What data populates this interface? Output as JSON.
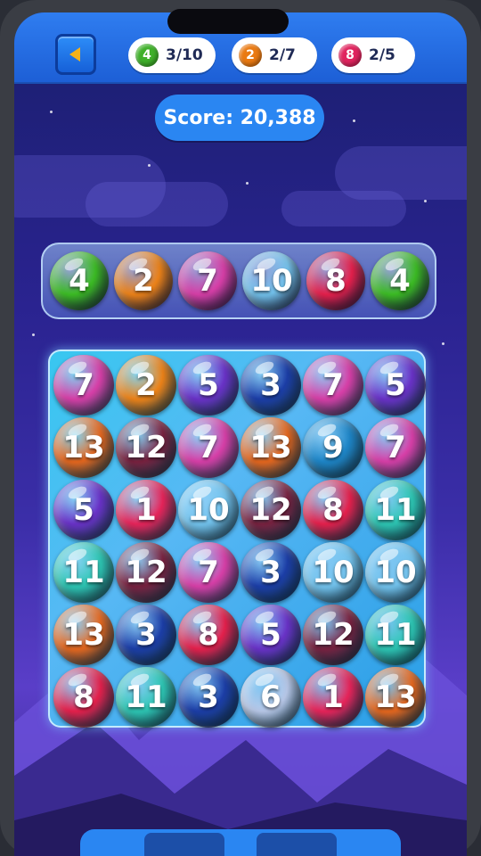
{
  "goals": [
    {
      "number": "4",
      "progress": "3/10",
      "color": "#3fb02a"
    },
    {
      "number": "2",
      "progress": "2/7",
      "color": "#ea7a12"
    },
    {
      "number": "8",
      "progress": "2/5",
      "color": "#e0245e"
    }
  ],
  "score_text": "Score: 20,388",
  "queue": [
    "4",
    "2",
    "7",
    "10",
    "8",
    "4"
  ],
  "grid": [
    [
      "7",
      "2",
      "5",
      "3",
      "7",
      "5"
    ],
    [
      "13",
      "12",
      "7",
      "13",
      "9",
      "7"
    ],
    [
      "5",
      "1",
      "10",
      "12",
      "8",
      "11"
    ],
    [
      "11",
      "12",
      "7",
      "3",
      "10",
      "10"
    ],
    [
      "13",
      "3",
      "8",
      "5",
      "12",
      "11"
    ],
    [
      "8",
      "11",
      "3",
      "6",
      "1",
      "13"
    ]
  ],
  "ball_colors": {
    "1": "#e8245a",
    "2": "#ee8318",
    "3": "#1c3ea8",
    "4": "#3cbd24",
    "5": "#6a32c8",
    "6": "#b8c8e8",
    "7": "#d83fa8",
    "8": "#e6204c",
    "9": "#1e86c8",
    "10": "#74c4ee",
    "11": "#2ec7b4",
    "12": "#7a2240",
    "13": "#e8681e"
  }
}
